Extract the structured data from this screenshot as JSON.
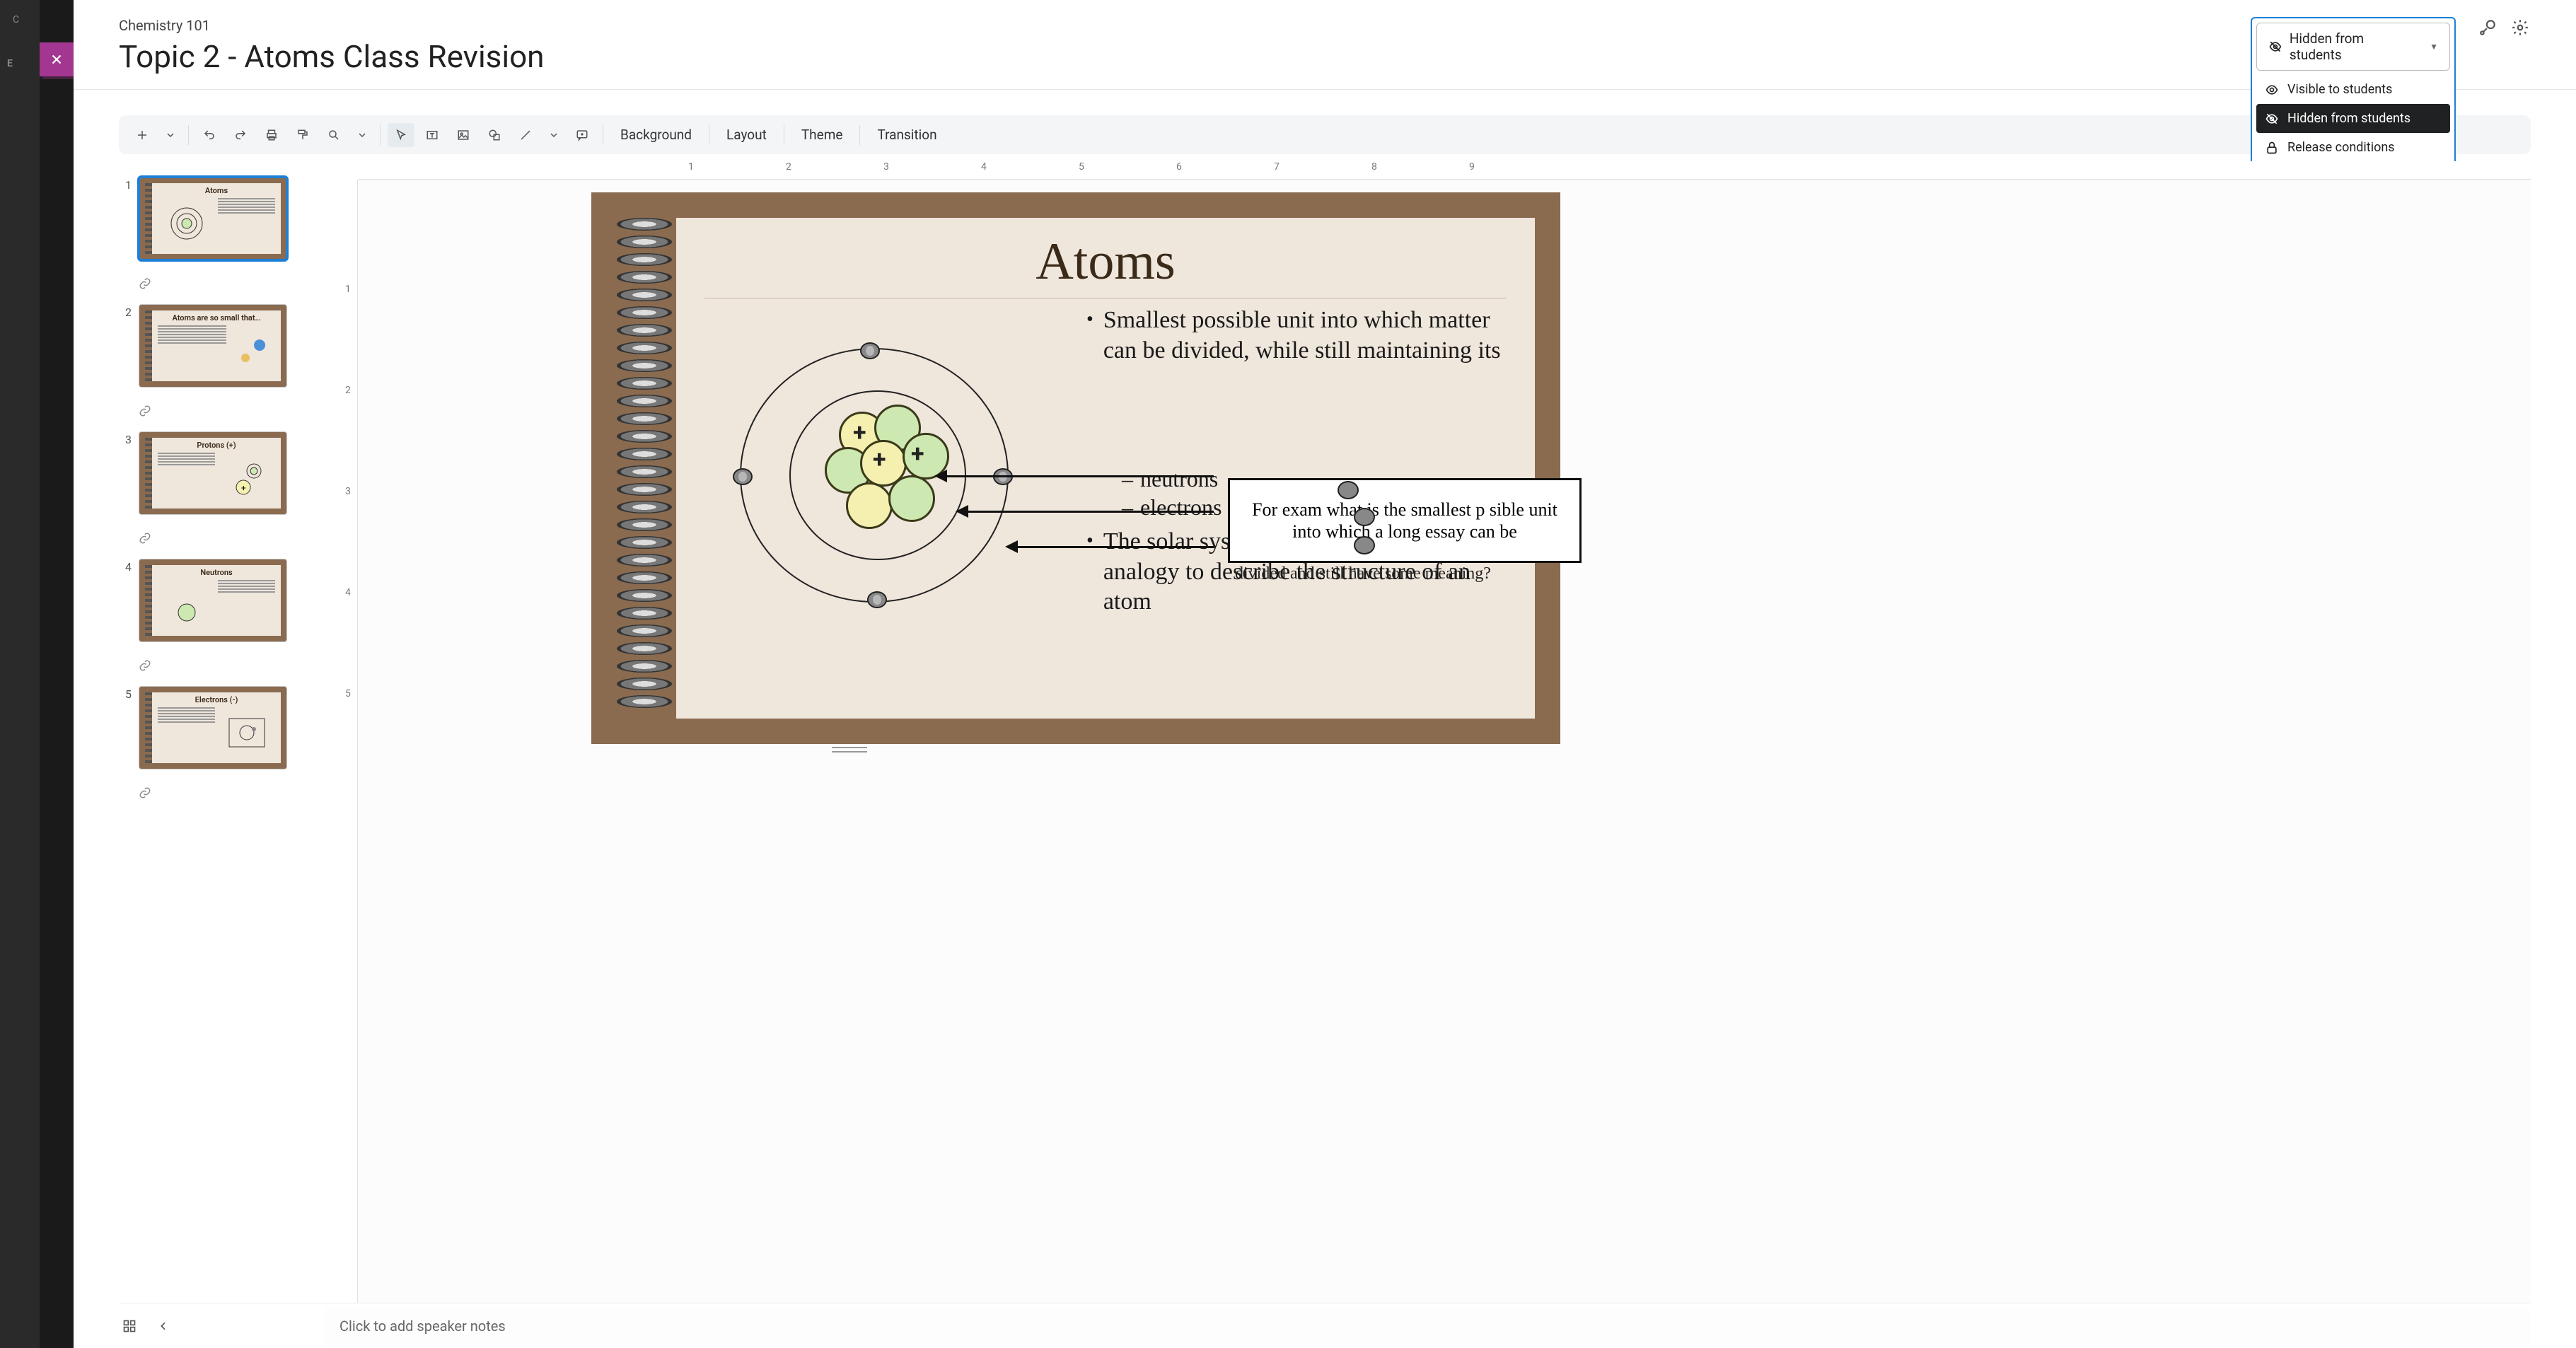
{
  "header": {
    "course": "Chemistry 101",
    "title": "Topic 2 - Atoms Class Revision"
  },
  "visibility": {
    "current": "Hidden from students",
    "options": [
      {
        "key": "visible",
        "label": "Visible to students"
      },
      {
        "key": "hidden",
        "label": "Hidden from students"
      },
      {
        "key": "release",
        "label": "Release conditions"
      }
    ]
  },
  "toolbar": {
    "background": "Background",
    "layout": "Layout",
    "theme": "Theme",
    "transition": "Transition"
  },
  "thumbs": [
    {
      "n": "1",
      "title": "Atoms"
    },
    {
      "n": "2",
      "title": "Atoms are so small that…"
    },
    {
      "n": "3",
      "title": "Protons (+)"
    },
    {
      "n": "4",
      "title": "Neutrons"
    },
    {
      "n": "5",
      "title": "Electrons (-)"
    }
  ],
  "ruler": {
    "h": [
      "1",
      "2",
      "3",
      "4",
      "5",
      "6",
      "7",
      "8",
      "9"
    ],
    "v": [
      "1",
      "2",
      "3",
      "4",
      "5"
    ]
  },
  "slide": {
    "title": "Atoms",
    "bullet1": "Smallest possible unit into which matter can be divided, while still maintaining its",
    "subs": {
      "neutrons": "neutrons",
      "electrons": "electrons"
    },
    "bullet2": "The solar system is commonly used as an analogy to describe the structure of an atom",
    "callout": "For exam     what is the smallest p    sible unit into which a long essay can be",
    "overtext": "divided and still have some meaning?"
  },
  "notes": {
    "placeholder": "Click to add speaker notes"
  }
}
